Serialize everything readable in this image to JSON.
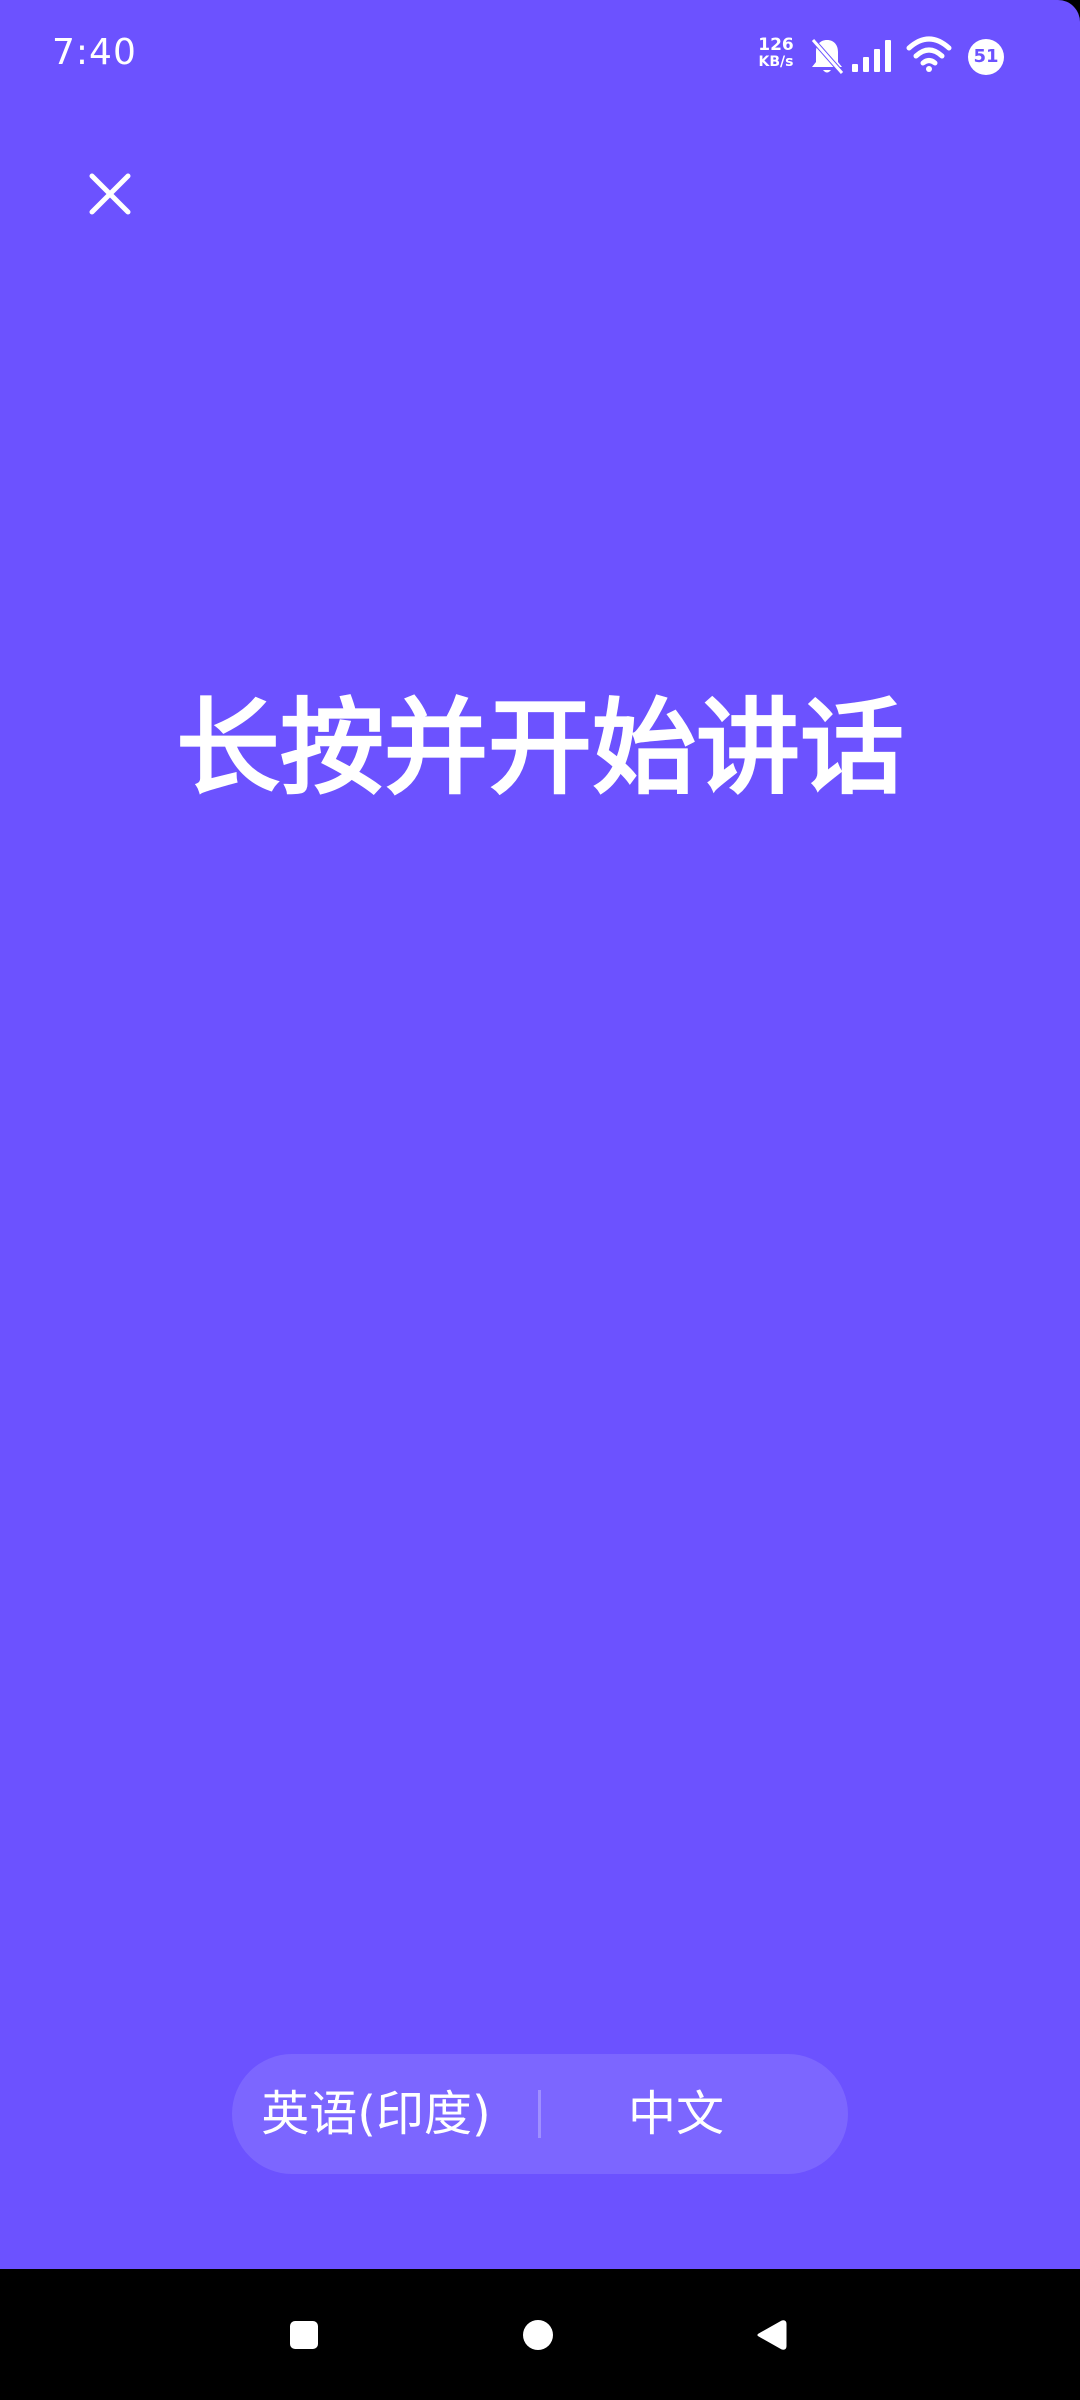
{
  "status_bar": {
    "time": "7:40",
    "net_speed_value": "126",
    "net_speed_unit": "KB/s",
    "battery": "51",
    "icons": [
      "notifications-off-icon",
      "signal-icon",
      "wifi-icon",
      "battery-icon"
    ]
  },
  "colors": {
    "background": "#6c52ff",
    "pill": "#7c66ff",
    "text": "#ffffff"
  },
  "header": {
    "close_icon": "close-icon"
  },
  "main": {
    "hint": "长按并开始讲话"
  },
  "language_selector": {
    "source": "英语(印度)",
    "target": "中文"
  },
  "nav_bar": {
    "icons": [
      "recents-icon",
      "home-icon",
      "back-icon"
    ]
  }
}
